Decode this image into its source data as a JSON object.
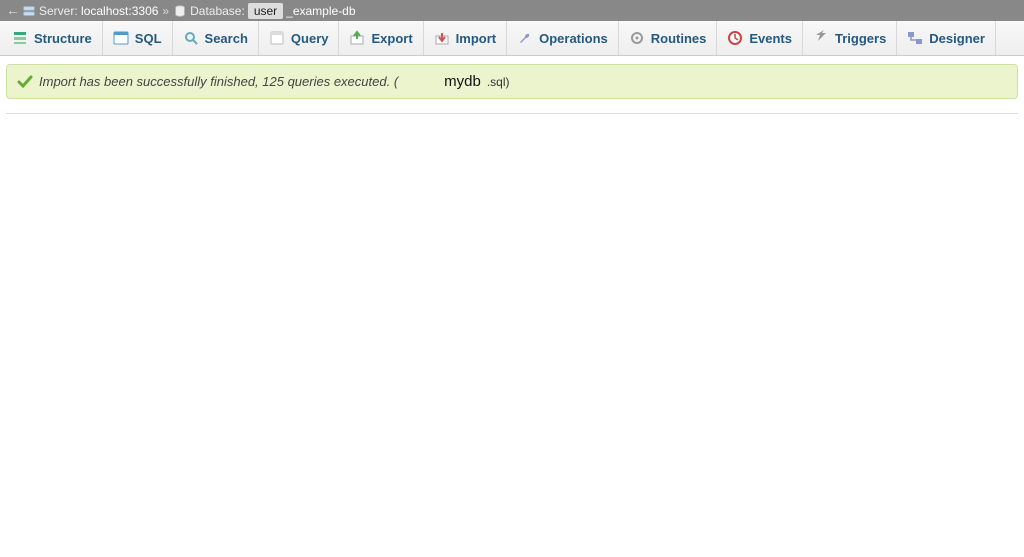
{
  "breadcrumb": {
    "server_label": "Server:",
    "server_value": "localhost:3306",
    "database_label": "Database:",
    "database_user": "user",
    "database_name": "_example-db"
  },
  "tabs": [
    {
      "id": "structure",
      "label": "Structure"
    },
    {
      "id": "sql",
      "label": "SQL"
    },
    {
      "id": "search",
      "label": "Search"
    },
    {
      "id": "query",
      "label": "Query"
    },
    {
      "id": "export",
      "label": "Export"
    },
    {
      "id": "import",
      "label": "Import"
    },
    {
      "id": "operations",
      "label": "Operations"
    },
    {
      "id": "routines",
      "label": "Routines"
    },
    {
      "id": "events",
      "label": "Events"
    },
    {
      "id": "triggers",
      "label": "Triggers"
    },
    {
      "id": "designer",
      "label": "Designer"
    }
  ],
  "message": {
    "text_prefix": "Import has been successfully finished, 125 queries executed. (",
    "filename": "mydb",
    "file_ext": ".sql)"
  },
  "icons": {
    "structure": "#3a7",
    "sql": "#59c",
    "search": "#6ab",
    "query": "#bbb",
    "export": "#5a5",
    "import": "#c55",
    "operations": "#89c",
    "routines": "#999",
    "events": "#c44",
    "triggers": "#999",
    "designer": "#89c",
    "server": "#cde",
    "database": "#eee",
    "check": "#6a3"
  }
}
